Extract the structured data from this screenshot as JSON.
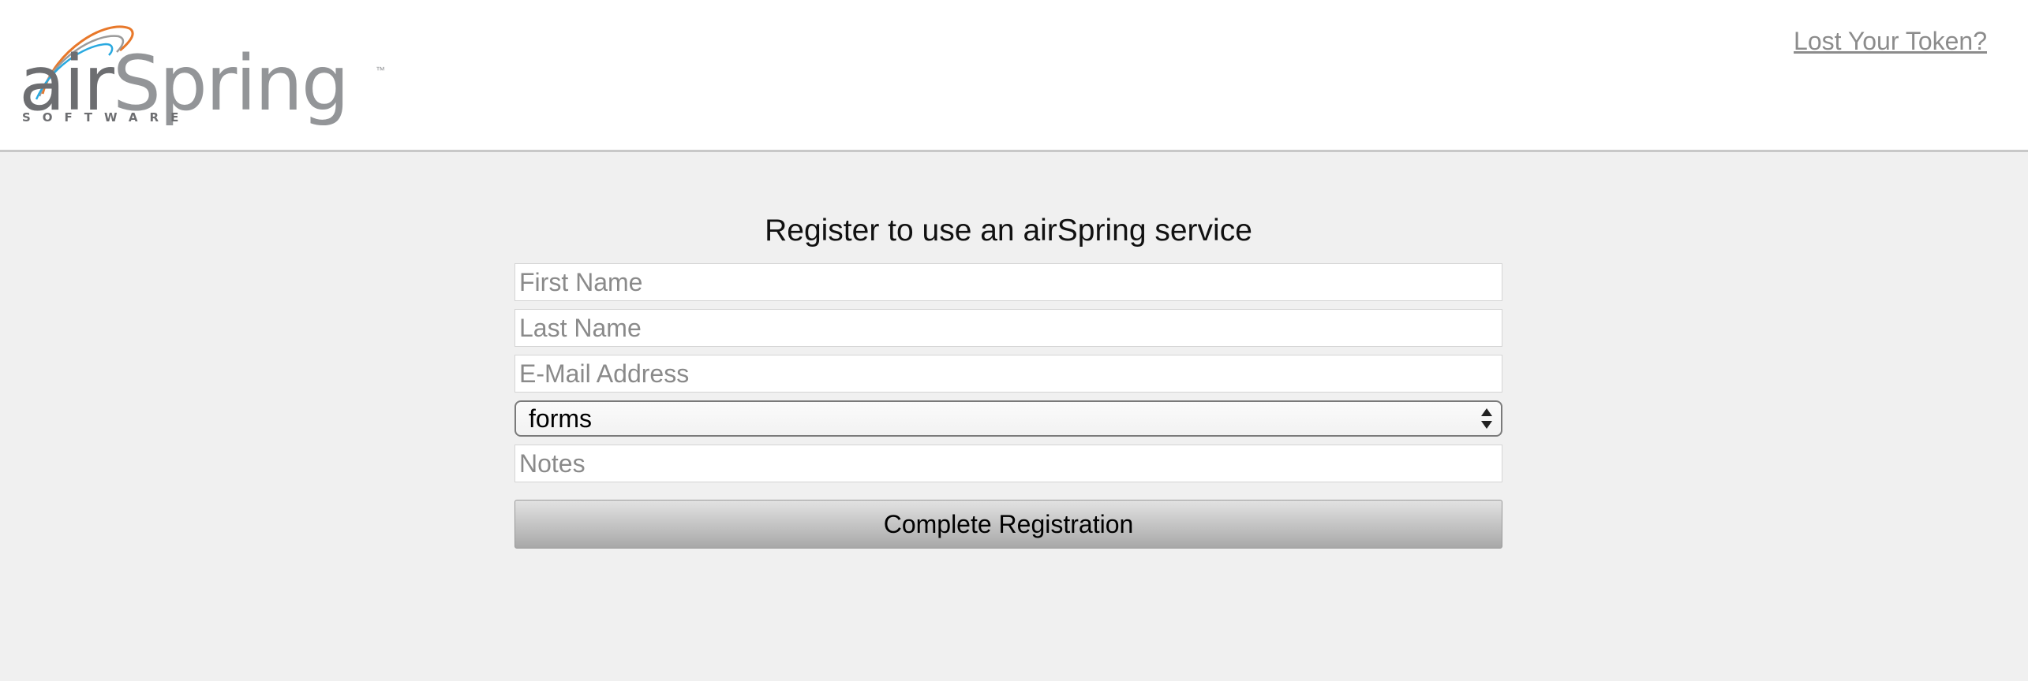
{
  "brand": {
    "logo_air": "air",
    "logo_spring": "Spring",
    "logo_tm": "™",
    "logo_sub": "SOFTWARE"
  },
  "header": {
    "lost_token_link": "Lost Your Token?"
  },
  "form": {
    "title": "Register to use an airSpring service",
    "first_name_placeholder": "First Name",
    "last_name_placeholder": "Last Name",
    "email_placeholder": "E-Mail Address",
    "service_selected": "forms",
    "notes_placeholder": "Notes",
    "submit_label": "Complete Registration"
  },
  "colors": {
    "page_background": "#f0f0f0",
    "header_background": "#ffffff",
    "link_color": "#8c8c8c",
    "logo_dark": "#6d6e71",
    "logo_light": "#939598",
    "swoosh_orange": "#e8782a",
    "swoosh_blue": "#29a9e0"
  },
  "icons": {
    "select_arrows": "up-down-triangles-icon",
    "logo_swoosh": "swoosh-icon"
  }
}
